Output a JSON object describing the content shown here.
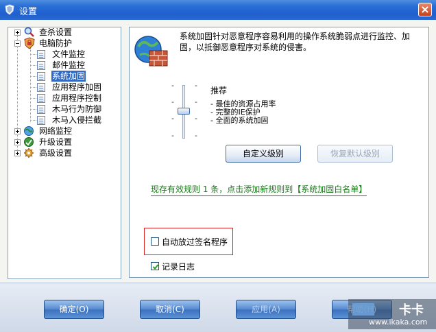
{
  "window": {
    "title": "设置"
  },
  "tree": {
    "items": [
      {
        "label": "查杀设置",
        "level": 0,
        "icon": "magnifier-icon"
      },
      {
        "label": "电脑防护",
        "level": 0,
        "icon": "shield-lock-icon"
      },
      {
        "label": "文件监控",
        "level": 1,
        "icon": "document-icon"
      },
      {
        "label": "邮件监控",
        "level": 1,
        "icon": "document-icon"
      },
      {
        "label": "系统加固",
        "level": 1,
        "icon": "document-icon",
        "selected": true
      },
      {
        "label": "应用程序加固",
        "level": 1,
        "icon": "document-icon"
      },
      {
        "label": "应用程序控制",
        "level": 1,
        "icon": "document-icon"
      },
      {
        "label": "木马行为防御",
        "level": 1,
        "icon": "document-icon"
      },
      {
        "label": "木马入侵拦截",
        "level": 1,
        "icon": "document-icon"
      },
      {
        "label": "网络监控",
        "level": 0,
        "icon": "network-globe-icon"
      },
      {
        "label": "升级设置",
        "level": 0,
        "icon": "update-globe-icon"
      },
      {
        "label": "高级设置",
        "level": 0,
        "icon": "gear-icon"
      }
    ]
  },
  "main": {
    "description": "系统加固针对恶意程序容易利用的操作系统脆弱点进行监控、加固，以抵御恶意程序对系统的侵害。",
    "level_title": "推荐",
    "level_items": [
      "- 最佳的资源占用率",
      "- 完整的IE保护",
      "- 全面的系统加固"
    ],
    "slider_ticks": [
      "-",
      "-",
      "-",
      "-",
      "-",
      "-",
      "-",
      "-"
    ],
    "custom_level_button": "自定义级别",
    "restore_default_button": "恢复默认级别",
    "rule_text": "现存有效规则 1 条，点击添加新规则到【系统加固白名单】",
    "auto_skip_signed": {
      "label": "自动放过签名程序",
      "checked": false
    },
    "log": {
      "label": "记录日志",
      "checked": true
    }
  },
  "footer": {
    "ok_button": "确定(O)",
    "cancel_button": "取消(C)",
    "apply_button": "应用(A)",
    "help_button": "帮助(H)"
  },
  "watermark": {
    "line1": "卡卡",
    "line2": "www.ikaka.com"
  },
  "colors": {
    "titlebar": "#2a6fd6",
    "selection": "#316ac5",
    "rule_text": "#1a7a1a",
    "highlight": "#dd2222"
  }
}
